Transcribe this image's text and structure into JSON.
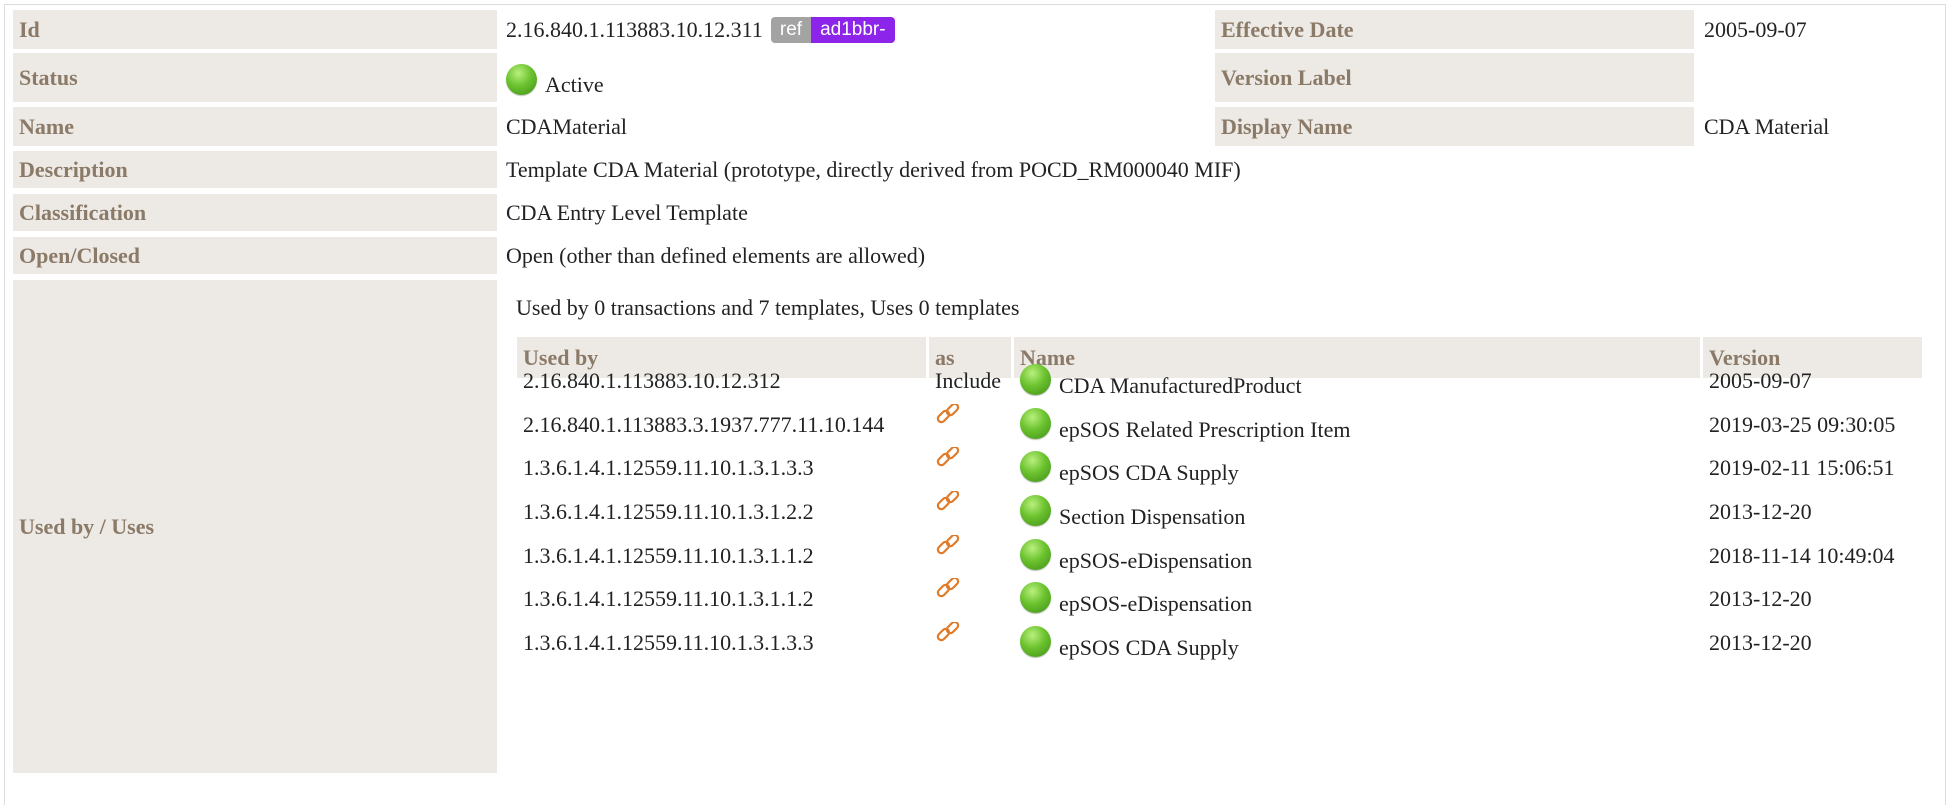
{
  "labels": {
    "id": "Id",
    "effective_date": "Effective Date",
    "status": "Status",
    "version_label": "Version Label",
    "name": "Name",
    "display_name": "Display Name",
    "description": "Description",
    "classification": "Classification",
    "open_closed": "Open/Closed",
    "used_by_uses": "Used by / Uses"
  },
  "values": {
    "id": "2.16.840.1.113883.10.12.311",
    "ref_badge": "ref",
    "ref_id": "ad1bbr-",
    "effective_date": "2005-09-07",
    "status": "Active",
    "version_label": "",
    "name": "CDAMaterial",
    "display_name": "CDA Material",
    "description": "Template CDA Material (prototype, directly derived from POCD_RM000040 MIF)",
    "classification": "CDA Entry Level Template",
    "open_closed": "Open (other than defined elements are allowed)"
  },
  "usage": {
    "summary": "Used by 0 transactions and 7 templates, Uses 0 templates",
    "headers": {
      "used_by": "Used by",
      "as": "as",
      "name": "Name",
      "version": "Version"
    },
    "rows": [
      {
        "used_by": "2.16.840.1.113883.10.12.312",
        "as": "Include",
        "name": "CDA ManufacturedProduct",
        "version": "2005-09-07"
      },
      {
        "used_by": "2.16.840.1.113883.3.1937.777.11.10.144",
        "as": "",
        "name": "epSOS Related Prescription Item",
        "version": "2019-03-25 09:30:05"
      },
      {
        "used_by": "1.3.6.1.4.1.12559.11.10.1.3.1.3.3",
        "as": "",
        "name": "epSOS CDA Supply",
        "version": "2019-02-11 15:06:51"
      },
      {
        "used_by": "1.3.6.1.4.1.12559.11.10.1.3.1.2.2",
        "as": "",
        "name": "Section Dispensation",
        "version": "2013-12-20"
      },
      {
        "used_by": "1.3.6.1.4.1.12559.11.10.1.3.1.1.2",
        "as": "",
        "name": "epSOS-eDispensation",
        "version": "2018-11-14 10:49:04"
      },
      {
        "used_by": "1.3.6.1.4.1.12559.11.10.1.3.1.1.2",
        "as": "",
        "name": "epSOS-eDispensation",
        "version": "2013-12-20"
      },
      {
        "used_by": "1.3.6.1.4.1.12559.11.10.1.3.1.3.3",
        "as": "",
        "name": "epSOS CDA Supply",
        "version": "2013-12-20"
      }
    ]
  },
  "icons": {
    "status": "green-status-dot-icon",
    "link": "link-icon"
  },
  "colors": {
    "label_bg": "#ede9e5",
    "label_text": "#8a7a67",
    "ref_badge": "#a3a3a3",
    "id_badge": "#8d24ea",
    "link": "#e07b2a"
  }
}
